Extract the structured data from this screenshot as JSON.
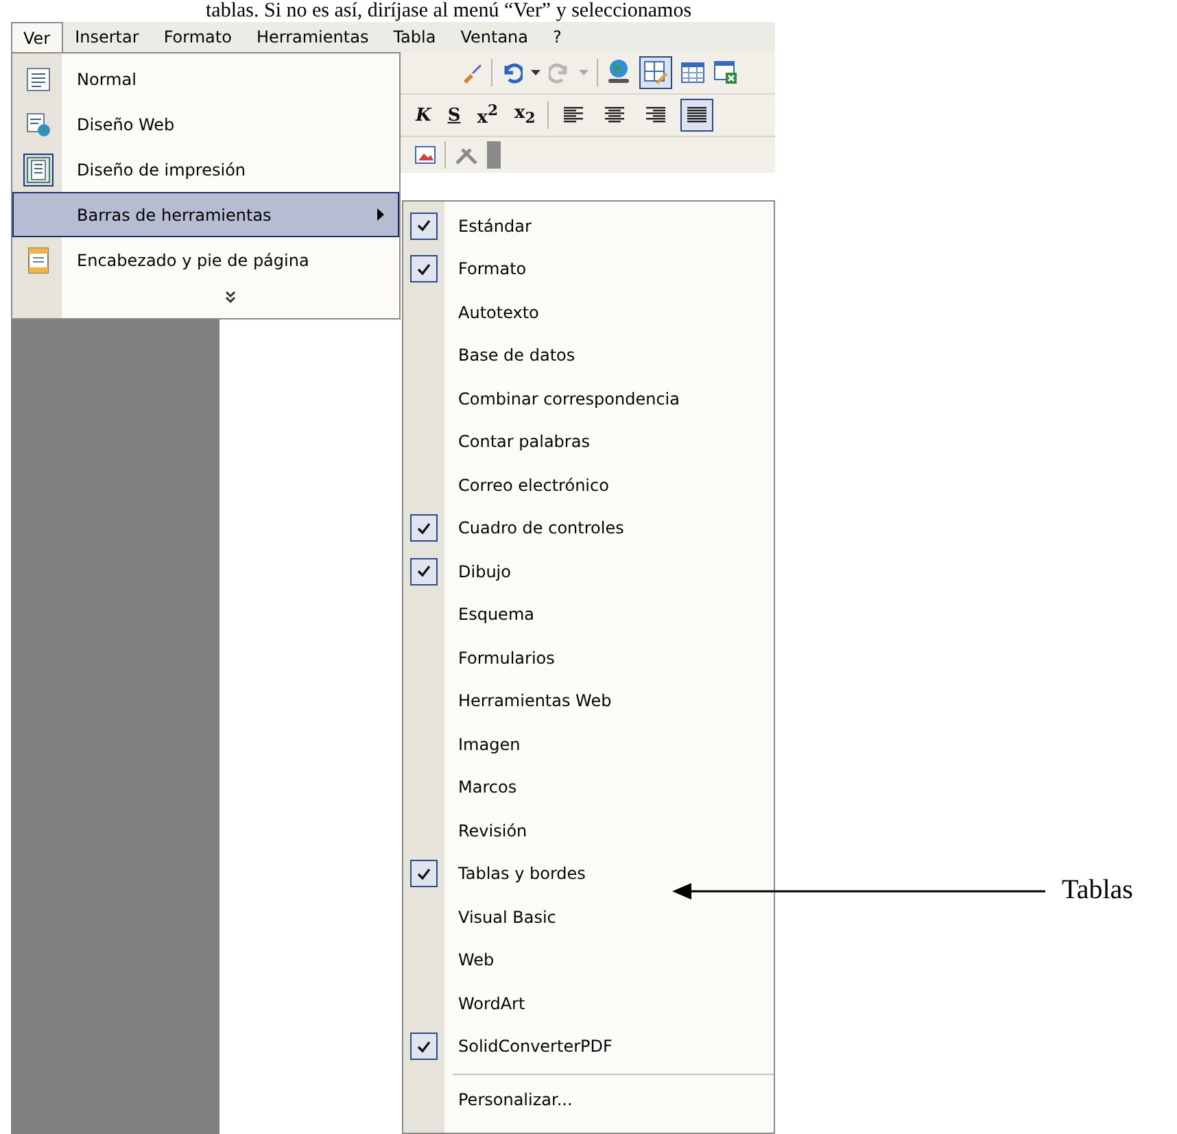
{
  "document_text": "tablas. Si no es así, diríjase al menú “Ver” y seleccionamos",
  "menu_bar": [
    {
      "label": "Ver",
      "selected": true
    },
    {
      "label": "Insertar",
      "selected": false
    },
    {
      "label": "Formato",
      "selected": false
    },
    {
      "label": "Herramientas",
      "selected": false
    },
    {
      "label": "Tabla",
      "selected": false
    },
    {
      "label": "Ventana",
      "selected": false
    },
    {
      "label": "?",
      "selected": false
    }
  ],
  "view_menu": {
    "items": [
      {
        "label": "Normal",
        "kind": "normal-view",
        "checked": false,
        "selected": false
      },
      {
        "label": "Diseño Web",
        "kind": "web-view",
        "checked": false,
        "selected": false
      },
      {
        "label": "Diseño de impresión",
        "kind": "print-view",
        "checked": true,
        "selected": false
      },
      {
        "label": "Barras de herramientas",
        "kind": "submenu",
        "checked": false,
        "selected": true
      },
      {
        "label": "Encabezado y pie de página",
        "kind": "header-footer",
        "checked": false,
        "selected": false
      }
    ]
  },
  "format_toolbar": [
    {
      "label": "K",
      "kind": "italic"
    },
    {
      "label": "S",
      "kind": "shadow"
    },
    {
      "label": "x$^{2}$",
      "kind": "plain"
    },
    {
      "label": "x$_{2}$",
      "kind": "plain"
    }
  ],
  "toolbars_menu": {
    "items": [
      {
        "label": "Estándar",
        "checked": true
      },
      {
        "label": "Formato",
        "checked": true
      },
      {
        "label": "Autotexto",
        "checked": false
      },
      {
        "label": "Base de datos",
        "checked": false
      },
      {
        "label": "Combinar correspondencia",
        "checked": false
      },
      {
        "label": "Contar palabras",
        "checked": false
      },
      {
        "label": "Correo electrónico",
        "checked": false
      },
      {
        "label": "Cuadro de controles",
        "checked": true
      },
      {
        "label": "Dibujo",
        "checked": true
      },
      {
        "label": "Esquema",
        "checked": false
      },
      {
        "label": "Formularios",
        "checked": false
      },
      {
        "label": "Herramientas Web",
        "checked": false
      },
      {
        "label": "Imagen",
        "checked": false
      },
      {
        "label": "Marcos",
        "checked": false
      },
      {
        "label": "Revisión",
        "checked": false
      },
      {
        "label": "Tablas y bordes",
        "checked": true
      },
      {
        "label": "Visual Basic",
        "checked": false
      },
      {
        "label": "Web",
        "checked": false
      },
      {
        "label": "WordArt",
        "checked": false
      },
      {
        "label": "SolidConverterPDF",
        "checked": true
      }
    ],
    "customize": "Personalizar..."
  },
  "annotation": {
    "label": "Tablas"
  }
}
